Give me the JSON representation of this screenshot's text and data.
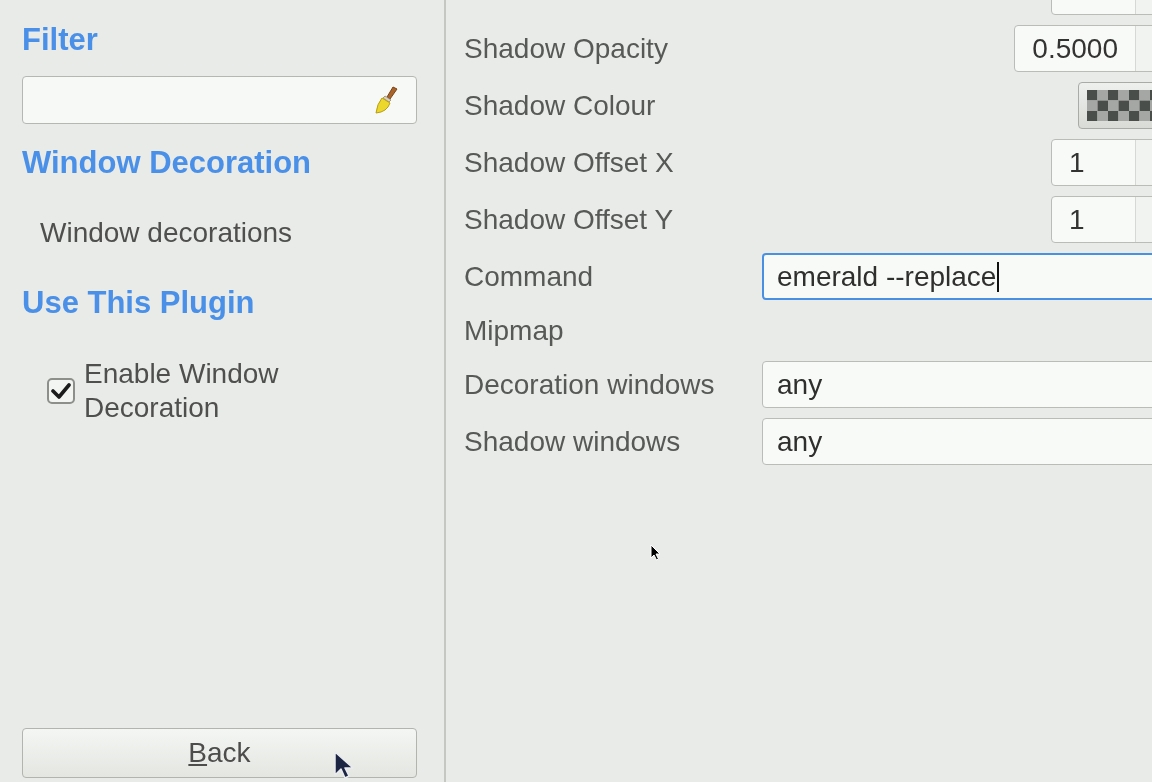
{
  "sidebar": {
    "filter_title": "Filter",
    "plugin_title": "Window Decoration",
    "plugin_description": "Window decorations",
    "use_title": "Use This Plugin",
    "enable_checkbox": {
      "label": "Enable Window Decoration",
      "checked": true
    },
    "back_button": {
      "label": "Back",
      "mnemonic_shown": true
    }
  },
  "settings": {
    "rows": [
      {
        "kind": "number"
      },
      {
        "kind": "number",
        "label": "Shadow Opacity",
        "value": "0.5000"
      },
      {
        "kind": "colour",
        "label": "Shadow Colour"
      },
      {
        "kind": "number",
        "label": "Shadow Offset X",
        "value": "1"
      },
      {
        "kind": "number",
        "label": "Shadow Offset Y",
        "value": "1"
      },
      {
        "kind": "text",
        "label": "Command",
        "value": "emerald --replace",
        "focused": true
      },
      {
        "kind": "plain",
        "label": "Mipmap"
      },
      {
        "kind": "text",
        "label": "Decoration windows",
        "value": "any",
        "focused": false
      },
      {
        "kind": "text",
        "label": "Shadow windows",
        "value": "any",
        "focused": false
      }
    ]
  }
}
